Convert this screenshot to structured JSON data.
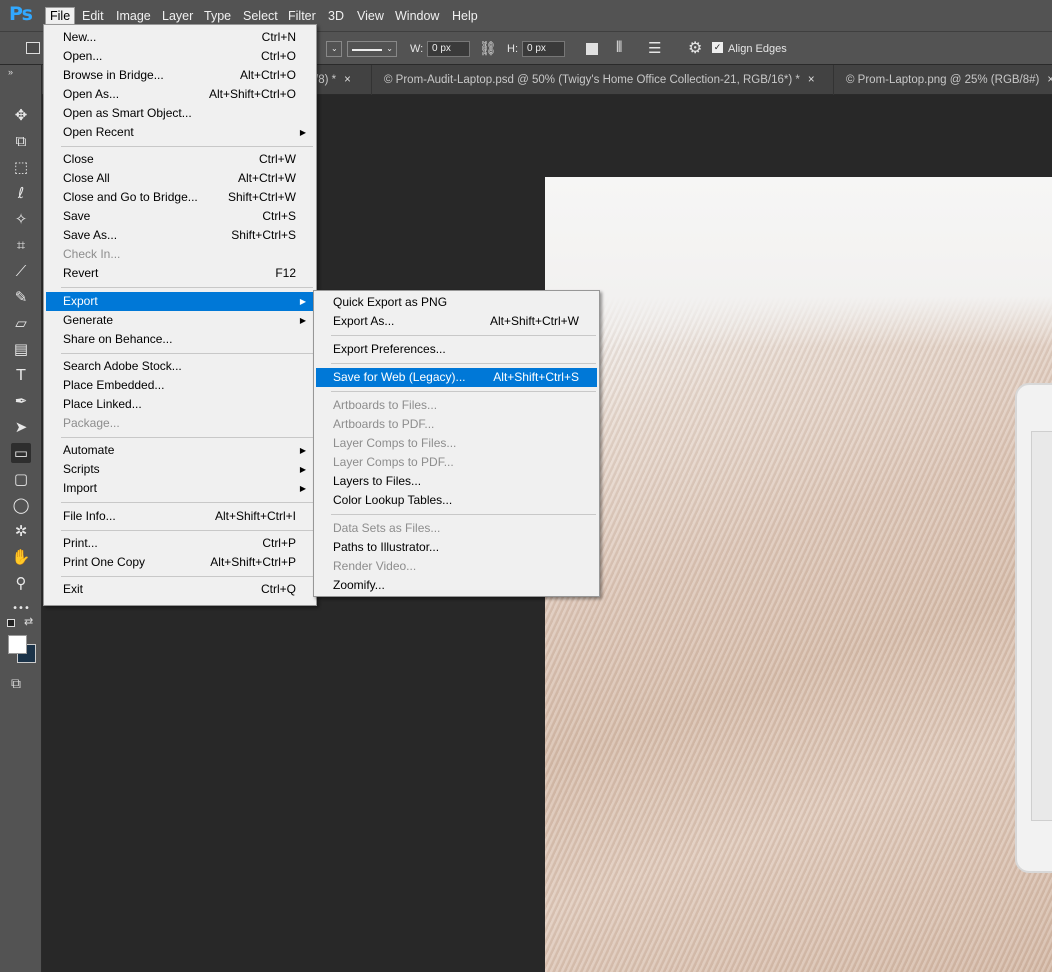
{
  "app": {
    "logo": "Ps"
  },
  "menubar": [
    {
      "label": "File",
      "active": true
    },
    {
      "label": "Edit"
    },
    {
      "label": "Image"
    },
    {
      "label": "Layer"
    },
    {
      "label": "Type"
    },
    {
      "label": "Select"
    },
    {
      "label": "Filter"
    },
    {
      "label": "3D"
    },
    {
      "label": "View"
    },
    {
      "label": "Window"
    },
    {
      "label": "Help"
    }
  ],
  "options": {
    "w_label": "W:",
    "w_value": "0 px",
    "h_label": "H:",
    "h_value": "0 px",
    "align_edges": "Align Edges",
    "align_edges_checked": true
  },
  "tabs": [
    {
      "label": "/8) *",
      "close": "×"
    },
    {
      "label": "© Prom-Audit-Laptop.psd @ 50% (Twigy's Home Office Collection-21, RGB/16*) *",
      "close": "×"
    },
    {
      "label": "© Prom-Laptop.png @ 25% (RGB/8#)",
      "close": "×"
    }
  ],
  "file_menu": {
    "items": [
      {
        "label": "New...",
        "shortcut": "Ctrl+N"
      },
      {
        "label": "Open...",
        "shortcut": "Ctrl+O"
      },
      {
        "label": "Browse in Bridge...",
        "shortcut": "Alt+Ctrl+O"
      },
      {
        "label": "Open As...",
        "shortcut": "Alt+Shift+Ctrl+O"
      },
      {
        "label": "Open as Smart Object...",
        "shortcut": ""
      },
      {
        "label": "Open Recent",
        "shortcut": "",
        "submenu": true
      },
      {
        "sep": true
      },
      {
        "label": "Close",
        "shortcut": "Ctrl+W"
      },
      {
        "label": "Close All",
        "shortcut": "Alt+Ctrl+W"
      },
      {
        "label": "Close and Go to Bridge...",
        "shortcut": "Shift+Ctrl+W"
      },
      {
        "label": "Save",
        "shortcut": "Ctrl+S"
      },
      {
        "label": "Save As...",
        "shortcut": "Shift+Ctrl+S"
      },
      {
        "label": "Check In...",
        "shortcut": "",
        "disabled": true
      },
      {
        "label": "Revert",
        "shortcut": "F12"
      },
      {
        "sep": true
      },
      {
        "label": "Export",
        "shortcut": "",
        "submenu": true,
        "highlight": true
      },
      {
        "label": "Generate",
        "shortcut": "",
        "submenu": true
      },
      {
        "label": "Share on Behance...",
        "shortcut": ""
      },
      {
        "sep": true
      },
      {
        "label": "Search Adobe Stock...",
        "shortcut": ""
      },
      {
        "label": "Place Embedded...",
        "shortcut": ""
      },
      {
        "label": "Place Linked...",
        "shortcut": ""
      },
      {
        "label": "Package...",
        "shortcut": "",
        "disabled": true
      },
      {
        "sep": true
      },
      {
        "label": "Automate",
        "shortcut": "",
        "submenu": true
      },
      {
        "label": "Scripts",
        "shortcut": "",
        "submenu": true
      },
      {
        "label": "Import",
        "shortcut": "",
        "submenu": true
      },
      {
        "sep": true
      },
      {
        "label": "File Info...",
        "shortcut": "Alt+Shift+Ctrl+I"
      },
      {
        "sep": true
      },
      {
        "label": "Print...",
        "shortcut": "Ctrl+P"
      },
      {
        "label": "Print One Copy",
        "shortcut": "Alt+Shift+Ctrl+P"
      },
      {
        "sep": true
      },
      {
        "label": "Exit",
        "shortcut": "Ctrl+Q"
      }
    ]
  },
  "export_menu": {
    "items": [
      {
        "label": "Quick Export as PNG",
        "shortcut": ""
      },
      {
        "label": "Export As...",
        "shortcut": "Alt+Shift+Ctrl+W"
      },
      {
        "sep": true
      },
      {
        "label": "Export Preferences...",
        "shortcut": ""
      },
      {
        "sep": true
      },
      {
        "label": "Save for Web (Legacy)...",
        "shortcut": "Alt+Shift+Ctrl+S",
        "highlight": true
      },
      {
        "sep": true
      },
      {
        "label": "Artboards to Files...",
        "shortcut": "",
        "disabled": true
      },
      {
        "label": "Artboards to PDF...",
        "shortcut": "",
        "disabled": true
      },
      {
        "label": "Layer Comps to Files...",
        "shortcut": "",
        "disabled": true
      },
      {
        "label": "Layer Comps to PDF...",
        "shortcut": "",
        "disabled": true
      },
      {
        "label": "Layers to Files...",
        "shortcut": ""
      },
      {
        "label": "Color Lookup Tables...",
        "shortcut": ""
      },
      {
        "sep": true
      },
      {
        "label": "Data Sets as Files...",
        "shortcut": "",
        "disabled": true
      },
      {
        "label": "Paths to Illustrator...",
        "shortcut": ""
      },
      {
        "label": "Render Video...",
        "shortcut": "",
        "disabled": true
      },
      {
        "label": "Zoomify...",
        "shortcut": ""
      }
    ]
  },
  "toolbar": {
    "tools": [
      {
        "name": "move-tool-icon",
        "glyph": "✥"
      },
      {
        "name": "artboard-tool-icon",
        "glyph": "⧉"
      },
      {
        "name": "marquee-tool-icon",
        "glyph": "⬚"
      },
      {
        "name": "lasso-tool-icon",
        "glyph": "ℓ"
      },
      {
        "name": "magic-wand-tool-icon",
        "glyph": "✧"
      },
      {
        "name": "crop-tool-icon",
        "glyph": "⌗"
      },
      {
        "name": "eyedropper-tool-icon",
        "glyph": "⟋"
      },
      {
        "name": "brush-tool-icon",
        "glyph": "✎"
      },
      {
        "name": "eraser-tool-icon",
        "glyph": "▱"
      },
      {
        "name": "gradient-tool-icon",
        "glyph": "▤"
      },
      {
        "name": "type-tool-icon",
        "glyph": "T"
      },
      {
        "name": "pen-tool-icon",
        "glyph": "✒"
      },
      {
        "name": "path-selection-tool-icon",
        "glyph": "➤"
      },
      {
        "name": "rectangle-tool-icon",
        "glyph": "▭",
        "active": true
      },
      {
        "name": "rounded-rectangle-tool-icon",
        "glyph": "▢"
      },
      {
        "name": "ellipse-tool-icon",
        "glyph": "◯"
      },
      {
        "name": "custom-shape-tool-icon",
        "glyph": "✲"
      },
      {
        "name": "hand-tool-icon",
        "glyph": "✋"
      },
      {
        "name": "zoom-tool-icon",
        "glyph": "⚲"
      },
      {
        "name": "more-tools-icon",
        "glyph": "•••"
      }
    ],
    "foreground_color": "#ffffff",
    "background_color": "#1b3349"
  }
}
